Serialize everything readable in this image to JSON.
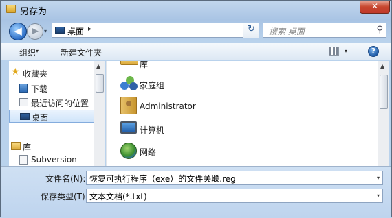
{
  "window": {
    "title": "另存为",
    "close_glyph": "✕"
  },
  "nav": {
    "back_glyph": "◀",
    "forward_glyph": "▶",
    "dropdown_glyph": "▾"
  },
  "address": {
    "location": "桌面",
    "chevron": "▸",
    "dropdown": "▾",
    "refresh_glyph": "↻"
  },
  "search": {
    "placeholder": "搜索 桌面",
    "icon": "search-icon"
  },
  "toolbar": {
    "organize": "组织",
    "organize_dd": "▾",
    "new_folder": "新建文件夹",
    "views_dd": "▾",
    "help": "?"
  },
  "sidebar": {
    "favorites": "收藏夹",
    "items": [
      {
        "label": "下载",
        "icon": "download-folder-icon"
      },
      {
        "label": "最近访问的位置",
        "icon": "recent-places-icon"
      },
      {
        "label": "桌面",
        "icon": "desktop-icon",
        "selected": true
      }
    ],
    "libraries": "库",
    "lib_items": [
      {
        "label": "Subversion",
        "icon": "document-icon"
      }
    ]
  },
  "main": {
    "items": [
      {
        "label": "库",
        "icon": "library-folder-icon"
      },
      {
        "label": "家庭组",
        "icon": "homegroup-icon"
      },
      {
        "label": "Administrator",
        "icon": "user-folder-icon"
      },
      {
        "label": "计算机",
        "icon": "computer-icon"
      },
      {
        "label": "网络",
        "icon": "network-icon"
      }
    ]
  },
  "form": {
    "filename_label": "文件名(N):",
    "filename_value": "恢复可执行程序（exe）的文件关联.reg",
    "filetype_label": "保存类型(T):",
    "filetype_value": "文本文档(*.txt)",
    "dropdown_glyph": "▾"
  },
  "scroll": {
    "up": "▲",
    "down": "▼"
  }
}
